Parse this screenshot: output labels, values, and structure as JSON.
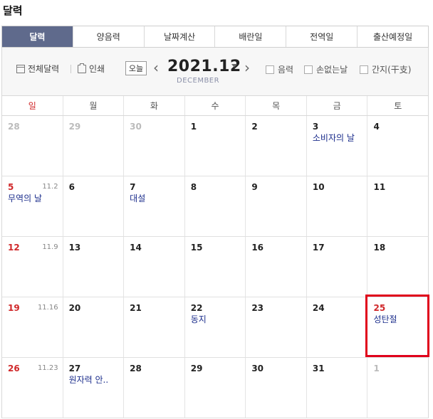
{
  "title": "달력",
  "tabs": [
    "달력",
    "양음력",
    "날짜계산",
    "배란일",
    "전역일",
    "출산예정일"
  ],
  "toolbar": {
    "full_calendar": "전체달력",
    "print": "인쇄",
    "today": "오늘",
    "month": "2021.12",
    "month_en": "DECEMBER",
    "lunar_checkbox": "음력",
    "sonless_checkbox": "손없는날",
    "ganji_checkbox": "간지(干支)"
  },
  "weekdays": [
    "일",
    "월",
    "화",
    "수",
    "목",
    "금",
    "토"
  ],
  "weeks": [
    [
      {
        "day": "28",
        "other": true
      },
      {
        "day": "29",
        "other": true
      },
      {
        "day": "30",
        "other": true
      },
      {
        "day": "1"
      },
      {
        "day": "2"
      },
      {
        "day": "3",
        "event": "소비자의 날"
      },
      {
        "day": "4"
      }
    ],
    [
      {
        "day": "5",
        "lunar": "11.2",
        "event": "무역의 날"
      },
      {
        "day": "6"
      },
      {
        "day": "7",
        "event": "대설"
      },
      {
        "day": "8"
      },
      {
        "day": "9"
      },
      {
        "day": "10"
      },
      {
        "day": "11"
      }
    ],
    [
      {
        "day": "12",
        "lunar": "11.9"
      },
      {
        "day": "13"
      },
      {
        "day": "14"
      },
      {
        "day": "15"
      },
      {
        "day": "16"
      },
      {
        "day": "17"
      },
      {
        "day": "18"
      }
    ],
    [
      {
        "day": "19",
        "lunar": "11.16"
      },
      {
        "day": "20"
      },
      {
        "day": "21"
      },
      {
        "day": "22",
        "event": "동지"
      },
      {
        "day": "23"
      },
      {
        "day": "24"
      },
      {
        "day": "25",
        "event": "성탄절",
        "holiday": true
      }
    ],
    [
      {
        "day": "26",
        "lunar": "11.23"
      },
      {
        "day": "27",
        "event": "원자력 안.."
      },
      {
        "day": "28"
      },
      {
        "day": "29"
      },
      {
        "day": "30"
      },
      {
        "day": "31"
      },
      {
        "day": "1",
        "other": true
      }
    ]
  ],
  "colors": {
    "tab_active": "#5f6a8c",
    "sunday": "#d0282a",
    "event": "#1c2e8c",
    "highlight": "#e0001b"
  }
}
